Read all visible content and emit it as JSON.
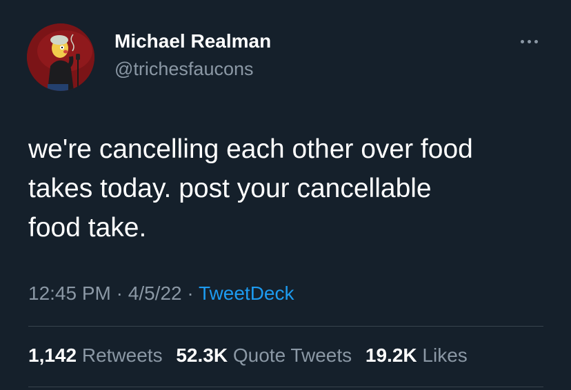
{
  "author": {
    "display_name": "Michael Realman",
    "handle": "@trichesfaucons"
  },
  "tweet": {
    "text": "we're cancelling each other over food\ntakes today. post your cancellable\nfood take.",
    "time": "12:45 PM",
    "date": "4/5/22",
    "separator": "·",
    "source": "TweetDeck"
  },
  "stats": {
    "retweets_count": "1,142",
    "retweets_label": "Retweets",
    "quotes_count": "52.3K",
    "quotes_label": "Quote Tweets",
    "likes_count": "19.2K",
    "likes_label": "Likes"
  },
  "icons": {
    "more": "more-options-icon"
  },
  "colors": {
    "background": "#15202b",
    "text_primary": "#ffffff",
    "text_secondary": "#8b98a5",
    "accent": "#1d9bf0",
    "divider": "#38444d"
  }
}
